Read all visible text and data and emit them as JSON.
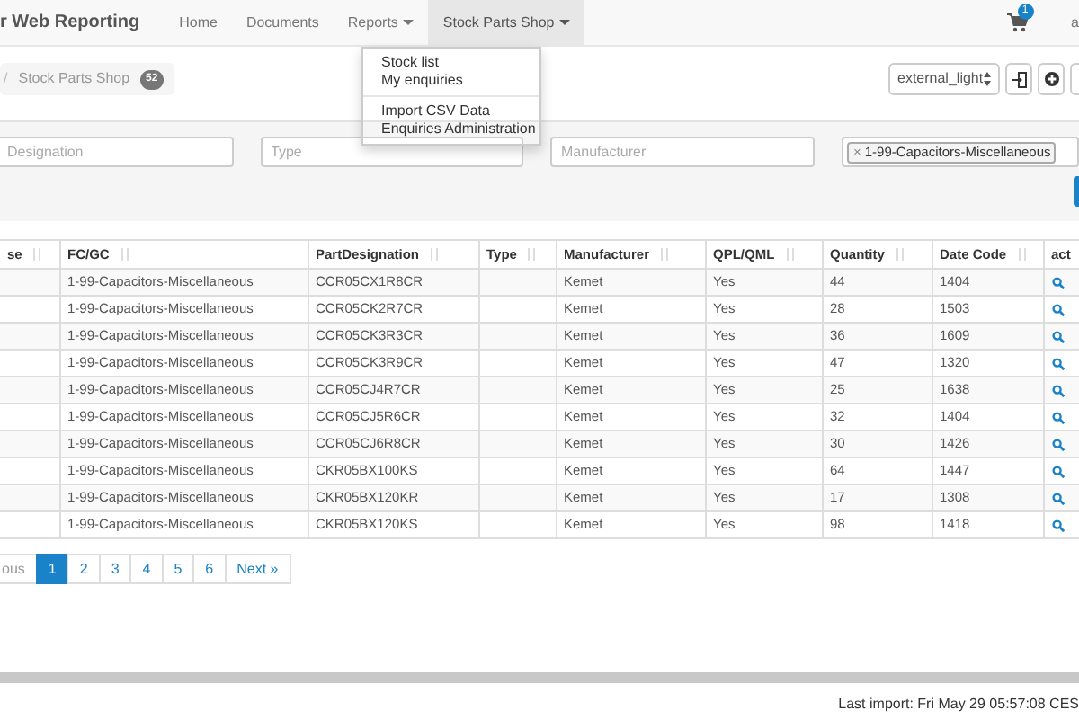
{
  "navbar": {
    "brand": "r Web Reporting",
    "links": [
      {
        "label": "Home",
        "dropdown": false,
        "selected": false
      },
      {
        "label": "Documents",
        "dropdown": false,
        "selected": false
      },
      {
        "label": "Reports",
        "dropdown": true,
        "selected": false
      },
      {
        "label": "Stock Parts Shop",
        "dropdown": true,
        "selected": true
      }
    ],
    "cart_badge": "1",
    "user": "a"
  },
  "dropdown_menu": {
    "groups": [
      [
        "Stock list",
        "My enquiries"
      ],
      [
        "Import CSV Data",
        "Enquiries Administration"
      ]
    ]
  },
  "breadcrumb": {
    "separator": "/",
    "label": "Stock Parts Shop",
    "badge": "52"
  },
  "toolbar": {
    "theme_select": "external_light"
  },
  "filters": [
    {
      "kind": "text",
      "placeholder": "Designation"
    },
    {
      "kind": "text",
      "placeholder": "Type"
    },
    {
      "kind": "text",
      "placeholder": "Manufacturer"
    },
    {
      "kind": "tags",
      "tags": [
        {
          "remove": "×",
          "label": "1-99-Capacitors-Miscellaneous"
        }
      ]
    }
  ],
  "table": {
    "columns": [
      {
        "label": "se",
        "sortable": true
      },
      {
        "label": "FC/GC",
        "sortable": true
      },
      {
        "label": "PartDesignation",
        "sortable": true
      },
      {
        "label": "Type",
        "sortable": true
      },
      {
        "label": "Manufacturer",
        "sortable": true
      },
      {
        "label": "QPL/QML",
        "sortable": true
      },
      {
        "label": "Quantity",
        "sortable": true
      },
      {
        "label": "Date Code",
        "sortable": true
      },
      {
        "label": "act",
        "sortable": false
      }
    ],
    "rows": [
      {
        "fc_gc": "1-99-Capacitors-Miscellaneous",
        "part": "CCR05CX1R8CR",
        "manufacturer": "Kemet",
        "qpl": "Yes",
        "quantity": "44",
        "date_code": "1404"
      },
      {
        "fc_gc": "1-99-Capacitors-Miscellaneous",
        "part": "CCR05CK2R7CR",
        "manufacturer": "Kemet",
        "qpl": "Yes",
        "quantity": "28",
        "date_code": "1503"
      },
      {
        "fc_gc": "1-99-Capacitors-Miscellaneous",
        "part": "CCR05CK3R3CR",
        "manufacturer": "Kemet",
        "qpl": "Yes",
        "quantity": "36",
        "date_code": "1609"
      },
      {
        "fc_gc": "1-99-Capacitors-Miscellaneous",
        "part": "CCR05CK3R9CR",
        "manufacturer": "Kemet",
        "qpl": "Yes",
        "quantity": "47",
        "date_code": "1320"
      },
      {
        "fc_gc": "1-99-Capacitors-Miscellaneous",
        "part": "CCR05CJ4R7CR",
        "manufacturer": "Kemet",
        "qpl": "Yes",
        "quantity": "25",
        "date_code": "1638"
      },
      {
        "fc_gc": "1-99-Capacitors-Miscellaneous",
        "part": "CCR05CJ5R6CR",
        "manufacturer": "Kemet",
        "qpl": "Yes",
        "quantity": "32",
        "date_code": "1404"
      },
      {
        "fc_gc": "1-99-Capacitors-Miscellaneous",
        "part": "CCR05CJ6R8CR",
        "manufacturer": "Kemet",
        "qpl": "Yes",
        "quantity": "30",
        "date_code": "1426"
      },
      {
        "fc_gc": "1-99-Capacitors-Miscellaneous",
        "part": "CKR05BX100KS",
        "manufacturer": "Kemet",
        "qpl": "Yes",
        "quantity": "64",
        "date_code": "1447"
      },
      {
        "fc_gc": "1-99-Capacitors-Miscellaneous",
        "part": "CKR05BX120KR",
        "manufacturer": "Kemet",
        "qpl": "Yes",
        "quantity": "17",
        "date_code": "1308"
      },
      {
        "fc_gc": "1-99-Capacitors-Miscellaneous",
        "part": "CKR05BX120KS",
        "manufacturer": "Kemet",
        "qpl": "Yes",
        "quantity": "98",
        "date_code": "1418"
      }
    ]
  },
  "pagination": {
    "previous": "ous",
    "pages": [
      {
        "label": "1",
        "selected": true
      },
      {
        "label": "2",
        "selected": false
      },
      {
        "label": "3",
        "selected": false
      },
      {
        "label": "4",
        "selected": false
      },
      {
        "label": "5",
        "selected": false
      },
      {
        "label": "6",
        "selected": false
      }
    ],
    "next": "Next »"
  },
  "footer": {
    "last_import": "Last import: Fri May 29 05:57:08 CES"
  }
}
